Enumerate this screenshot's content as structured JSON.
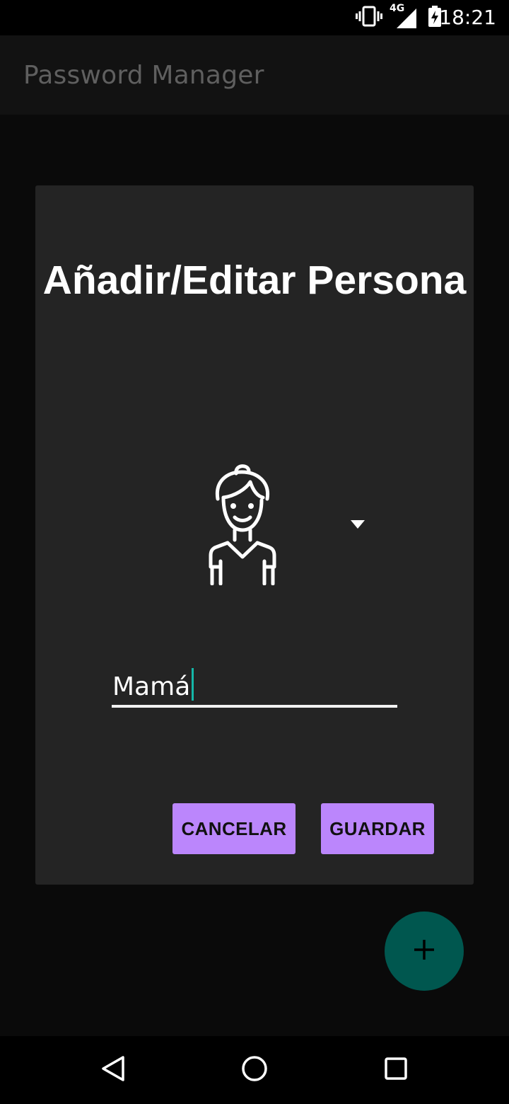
{
  "status_bar": {
    "time": "18:21",
    "network_label": "4G",
    "icons": [
      "vibrate-icon",
      "signal-icon",
      "battery-charging-icon"
    ]
  },
  "app_bar": {
    "title": "Password Manager"
  },
  "dialog": {
    "title": "Añadir/Editar Persona",
    "avatar": {
      "icon": "woman-icon",
      "dropdown_icon": "dropdown-arrow-icon"
    },
    "name_field": {
      "value": "Mamá"
    },
    "buttons": {
      "cancel_label": "CANCELAR",
      "save_label": "GUARDAR"
    }
  },
  "fab": {
    "icon": "plus-icon"
  },
  "nav_bar": {
    "items": [
      "back-icon",
      "home-icon",
      "recents-icon"
    ]
  },
  "colors": {
    "accent": "#bb86fc",
    "fab": "#00574f",
    "cursor": "#14b7a8",
    "dialog_bg": "#242424"
  }
}
